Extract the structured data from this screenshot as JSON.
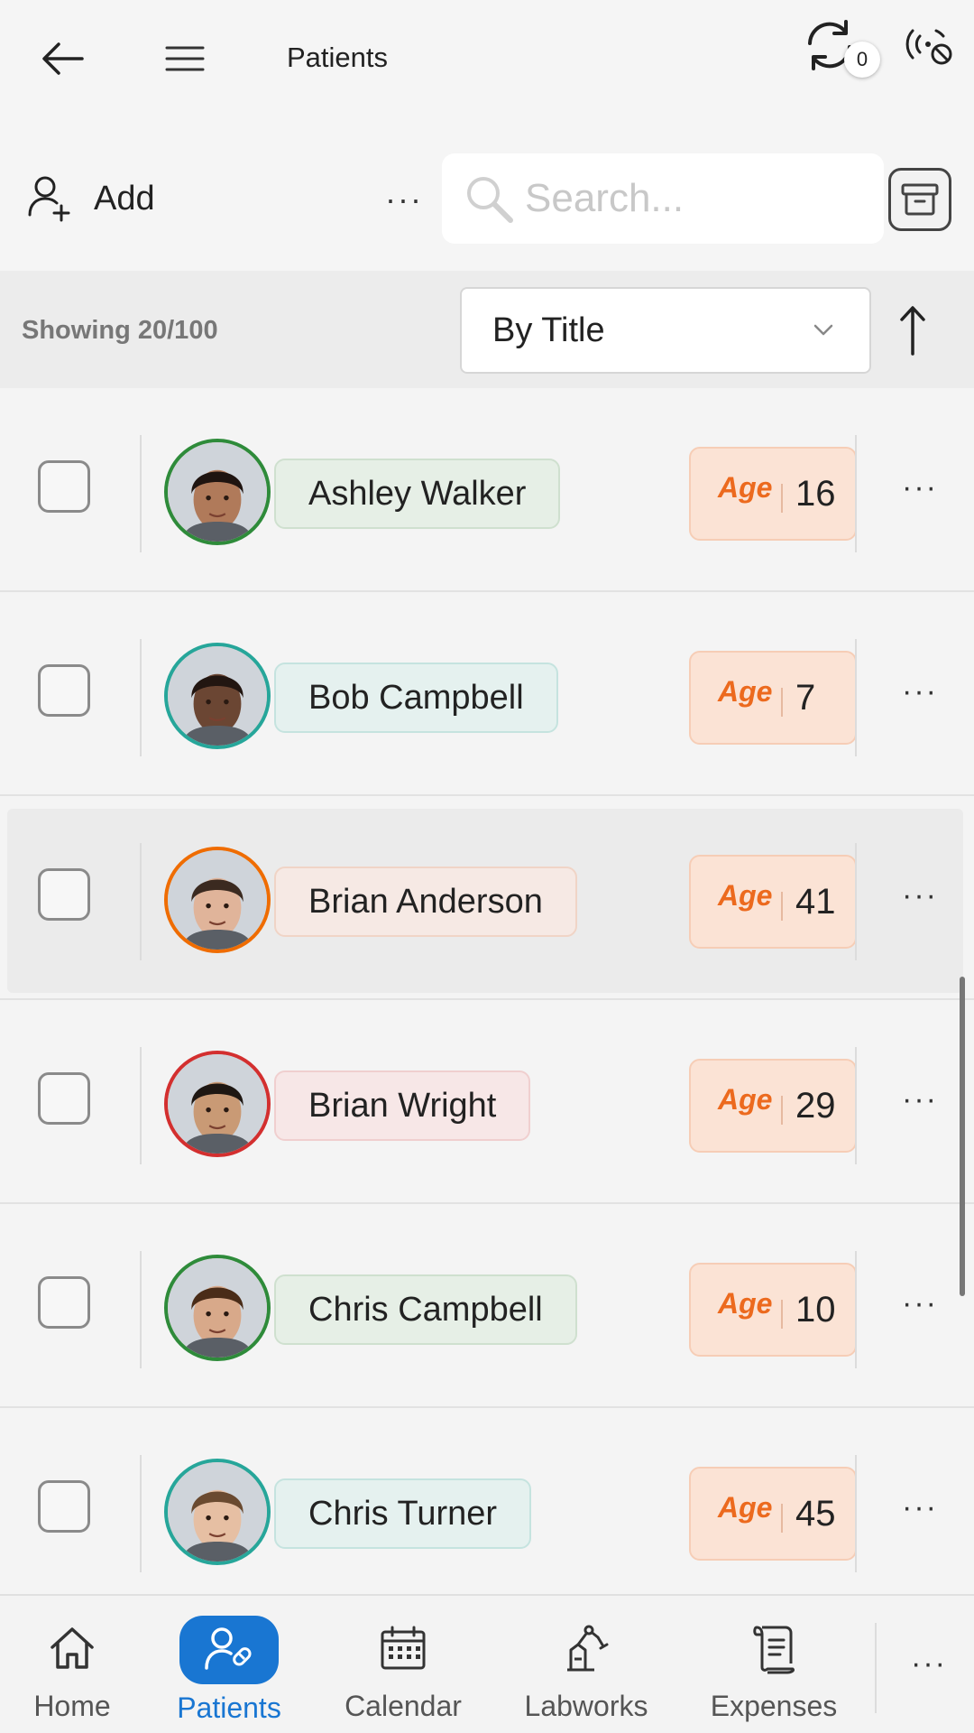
{
  "header": {
    "title": "Patients",
    "sync_count": "0",
    "icons": [
      "back-arrow-icon",
      "hamburger-menu-icon",
      "sync-icon",
      "offline-broadcast-icon"
    ]
  },
  "toolbar": {
    "add_label": "Add",
    "more_label": "···",
    "search_placeholder": "Search...",
    "search_value": ""
  },
  "sortbar": {
    "showing_text": "Showing 20/100",
    "sort_by": "By Title",
    "sort_direction": "ascending"
  },
  "patients": [
    {
      "name": "Ashley Walker",
      "age_label": "Age",
      "age": "16",
      "accent": "#2e8b3a",
      "chip_bg": "#e6efe6",
      "chip_border": "#cfe0cf",
      "skin": "#b07a5a",
      "hair": "#1f1410",
      "selected": false
    },
    {
      "name": "Bob Campbell",
      "age_label": "Age",
      "age": "7",
      "accent": "#26a69a",
      "chip_bg": "#e5f1ef",
      "chip_border": "#c5e3df",
      "skin": "#6b4633",
      "hair": "#221611",
      "selected": false
    },
    {
      "name": "Brian Anderson",
      "age_label": "Age",
      "age": "41",
      "accent": "#ef6c00",
      "chip_bg": "#f6e9e4",
      "chip_border": "#f0d4c6",
      "skin": "#e0b49a",
      "hair": "#3b2a20",
      "selected": false
    },
    {
      "name": "Brian Wright",
      "age_label": "Age",
      "age": "29",
      "accent": "#d32f2f",
      "chip_bg": "#f7e7e7",
      "chip_border": "#f0cfcf",
      "skin": "#c99a75",
      "hair": "#1e1712",
      "selected": false
    },
    {
      "name": "Chris Campbell",
      "age_label": "Age",
      "age": "10",
      "accent": "#2e8b3a",
      "chip_bg": "#e6efe6",
      "chip_border": "#cfe0cf",
      "skin": "#d8a98a",
      "hair": "#4a2c18",
      "selected": false
    },
    {
      "name": "Chris Turner",
      "age_label": "Age",
      "age": "45",
      "accent": "#26a69a",
      "chip_bg": "#e5f1ef",
      "chip_border": "#c5e3df",
      "skin": "#e6bfa3",
      "hair": "#6a4a30",
      "selected": false
    }
  ],
  "row_more_label": "···",
  "bottom_nav": {
    "items": [
      {
        "label": "Home",
        "icon": "home-icon",
        "active": false
      },
      {
        "label": "Patients",
        "icon": "patients-icon",
        "active": true
      },
      {
        "label": "Calendar",
        "icon": "calendar-icon",
        "active": false
      },
      {
        "label": "Labworks",
        "icon": "labworks-icon",
        "active": false
      },
      {
        "label": "Expenses",
        "icon": "expenses-icon",
        "active": false
      }
    ],
    "more_label": "···"
  },
  "colors": {
    "primary": "#1976d2",
    "age_accent": "#ec6a1e",
    "age_bg": "#fbe3d5"
  }
}
